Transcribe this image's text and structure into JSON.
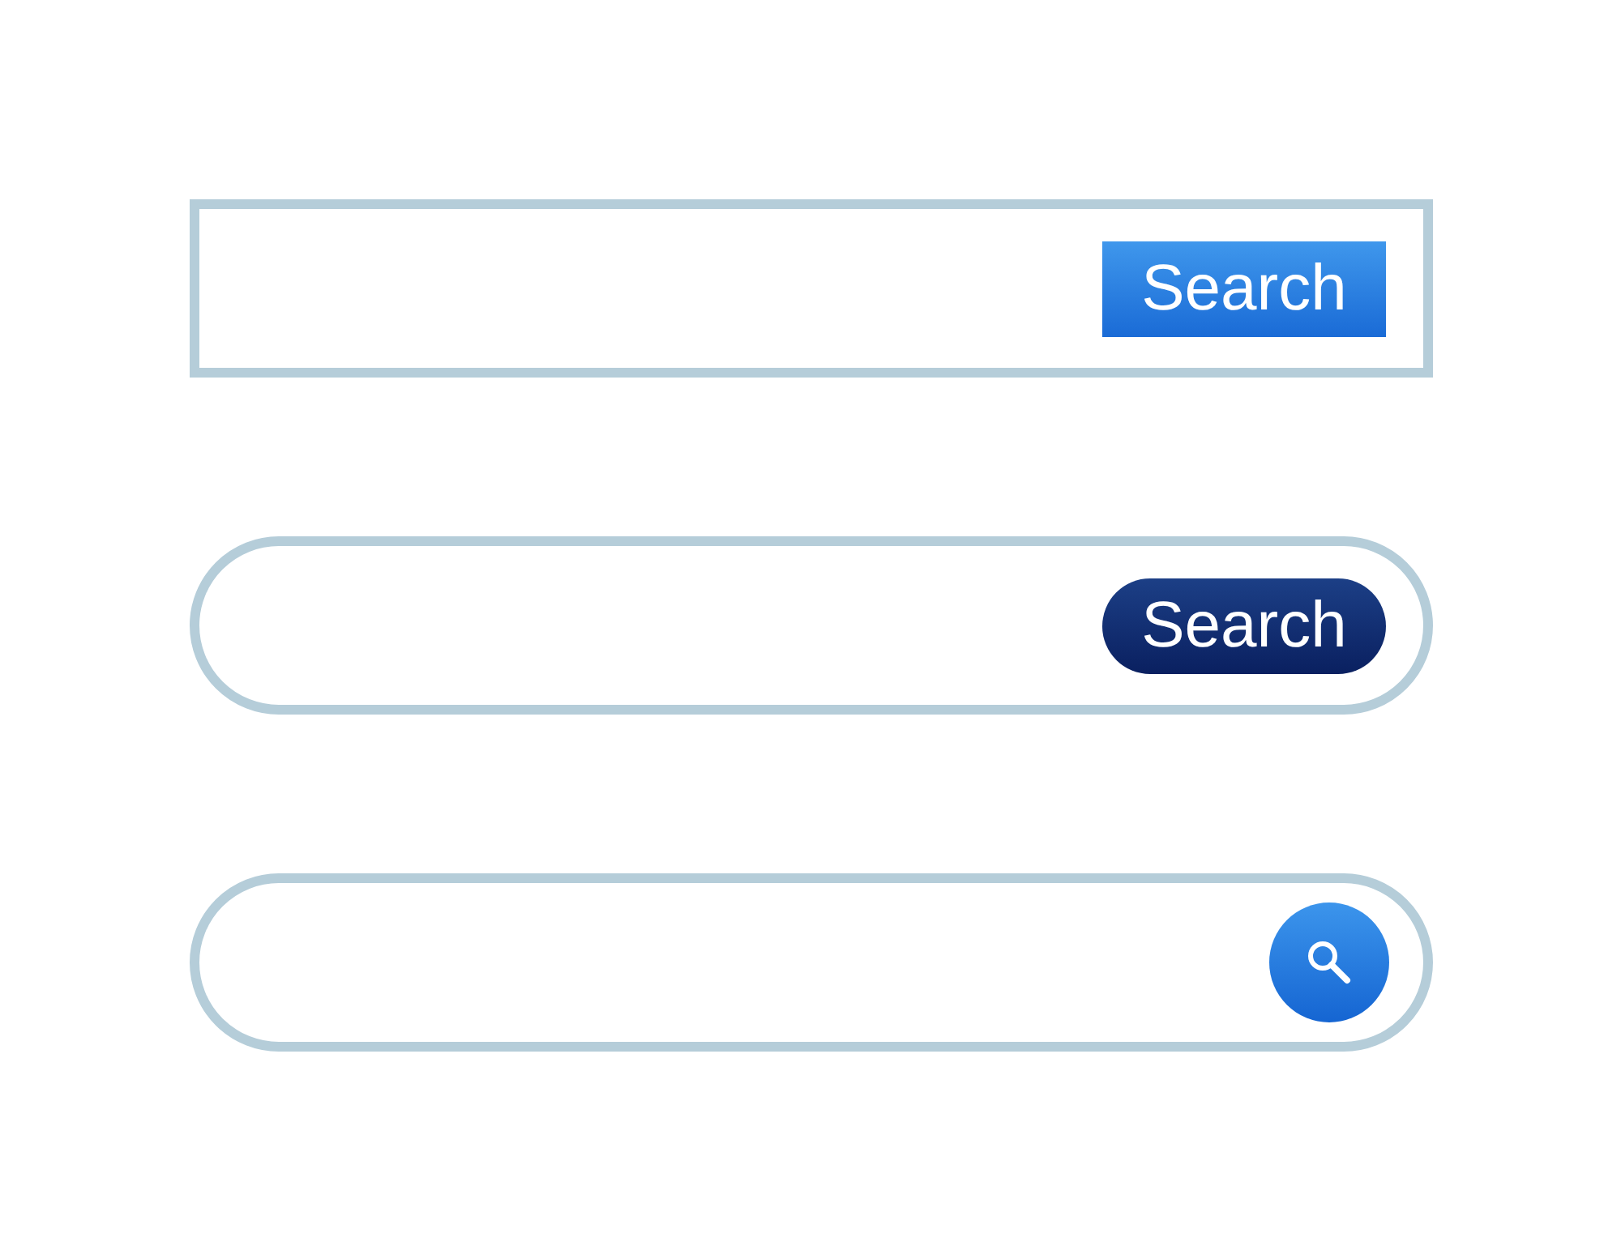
{
  "search_bars": [
    {
      "kind": "square",
      "button": {
        "kind": "text",
        "label": "Search"
      }
    },
    {
      "kind": "round",
      "button": {
        "kind": "text",
        "label": "Search"
      }
    },
    {
      "kind": "round",
      "button": {
        "kind": "icon"
      }
    }
  ]
}
